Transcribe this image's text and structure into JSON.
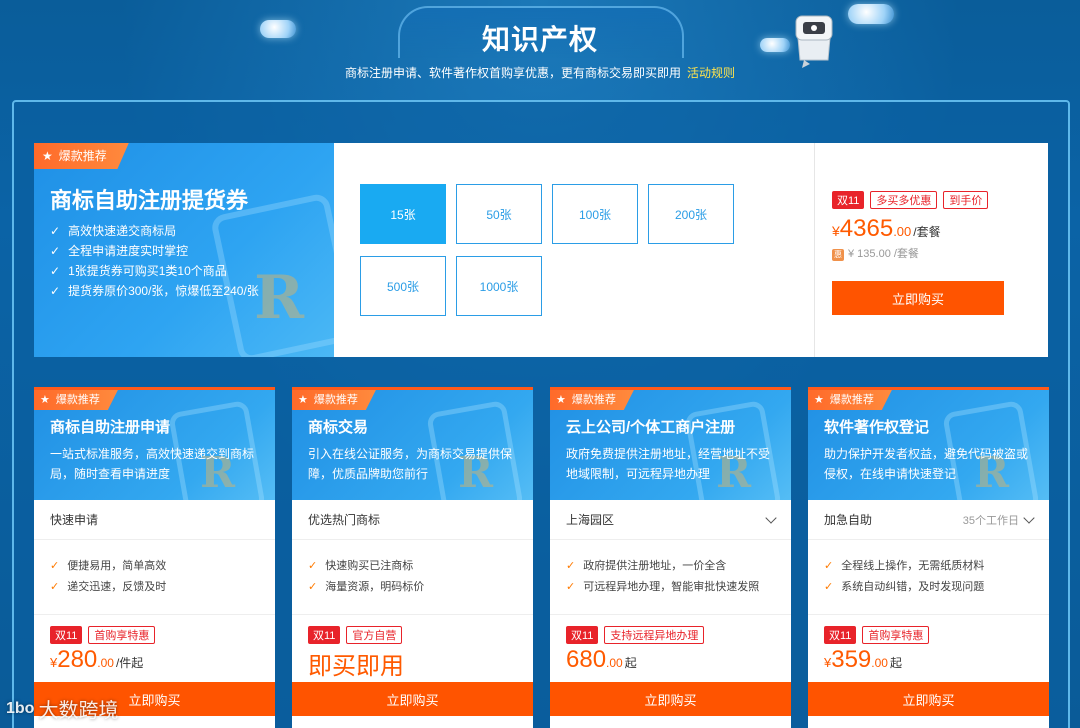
{
  "header": {
    "title": "知识产权",
    "subtitle": "商标注册申请、软件著作权首购享优惠，更有商标交易即买即用",
    "rules_link": "活动规则"
  },
  "feature": {
    "badge": "爆款推荐",
    "title": "商标自助注册提货券",
    "bullets": [
      "高效快速递交商标局",
      "全程申请进度实时掌控",
      "1张提货券可购买1类10个商品",
      "提货券原价300/张，惊爆低至240/张"
    ],
    "quantities": [
      "15张",
      "50张",
      "100张",
      "200张",
      "500张",
      "1000张"
    ],
    "selected_quantity": "15张",
    "tags": {
      "d11": "双11",
      "t1": "多买多优惠",
      "t2": "到手价"
    },
    "price_currency": "¥",
    "price_int": "4365",
    "price_dec": ".00",
    "price_unit": "/套餐",
    "original_price": "¥ 135.00 /套餐",
    "buy_label": "立即购买"
  },
  "cards": [
    {
      "badge": "爆款推荐",
      "title": "商标自助注册申请",
      "desc": "一站式标准服务，高效快速递交到商标局，随时查看申请进度",
      "select": "快速申请",
      "select_right": "",
      "features": [
        "便捷易用，简单高效",
        "递交迅速，反馈及时"
      ],
      "tag_d11": "双11",
      "tag_other": "首购享特惠",
      "price_currency": "¥",
      "price_int": "280",
      "price_dec": ".00",
      "price_unit": "/件起",
      "buy_label": "立即购买"
    },
    {
      "badge": "爆款推荐",
      "title": "商标交易",
      "desc": "引入在线公证服务，为商标交易提供保障，优质品牌助您前行",
      "select": "优选热门商标",
      "select_right": "",
      "features": [
        "快速购买已注商标",
        "海量资源，明码标价"
      ],
      "tag_d11": "双11",
      "tag_other": "官方自营",
      "price_text": "即买即用",
      "buy_label": "立即购买"
    },
    {
      "badge": "爆款推荐",
      "title": "云上公司/个体工商户注册",
      "desc": "政府免费提供注册地址，经营地址不受地域限制，可远程异地办理",
      "select": "上海园区",
      "select_right": "",
      "features": [
        "政府提供注册地址，一价全含",
        "可远程异地办理，智能审批快速发照"
      ],
      "tag_d11": "双11",
      "tag_other": "支持远程异地办理",
      "price_currency": "",
      "price_int": "680",
      "price_dec": ".00",
      "price_unit": "起",
      "buy_label": "立即购买"
    },
    {
      "badge": "爆款推荐",
      "title": "软件著作权登记",
      "desc": "助力保护开发者权益，避免代码被盗或侵权，在线申请快速登记",
      "select": "加急自助",
      "select_right": "35个工作日",
      "features": [
        "全程线上操作，无需纸质材料",
        "系统自动纠错，及时发现问题"
      ],
      "tag_d11": "双11",
      "tag_other": "首购享特惠",
      "price_currency": "¥",
      "price_int": "359",
      "price_dec": ".00",
      "price_unit": "起",
      "buy_label": "立即购买"
    }
  ],
  "watermark": {
    "logo": "1bo",
    "text": "大数跨境"
  }
}
